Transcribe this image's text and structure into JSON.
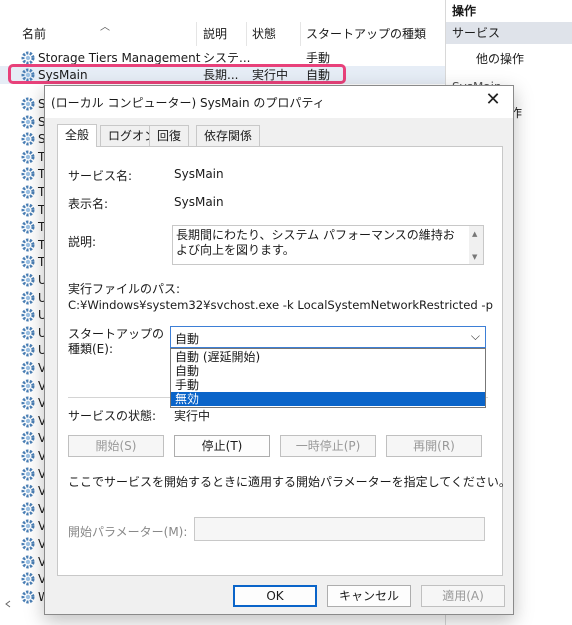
{
  "services_list": {
    "columns": {
      "name": "名前",
      "description": "説明",
      "status": "状態",
      "startup_type": "スタートアップの種類"
    },
    "rows": [
      {
        "name": "Storage Tiers Management",
        "description": "システ...",
        "status": "",
        "startup": "手動"
      },
      {
        "name": "SysMain",
        "description": "長期...",
        "status": "実行中",
        "startup": "自動"
      }
    ],
    "partial_rows": [
      "S",
      "S",
      "S",
      "T",
      "T",
      "T",
      "T",
      "T",
      "T",
      "T",
      "U",
      "U",
      "U",
      "U",
      "U",
      "V",
      "V",
      "V",
      "V",
      "V",
      "V",
      "V",
      "V",
      "V",
      "V",
      "V",
      "V",
      "V",
      "W"
    ]
  },
  "actions_pane": {
    "title": "操作",
    "section": "サービス",
    "item": "他の操作",
    "peek1": "SysMain",
    "peek2": "作"
  },
  "dialog": {
    "title": "(ローカル コンピューター) SysMain のプロパティ",
    "tabs": [
      {
        "label": "全般",
        "active": true
      },
      {
        "label": "ログオン",
        "active": false
      },
      {
        "label": "回復",
        "active": false
      },
      {
        "label": "依存関係",
        "active": false
      }
    ],
    "service_name_label": "サービス名:",
    "service_name": "SysMain",
    "display_name_label": "表示名:",
    "display_name": "SysMain",
    "description_label": "説明:",
    "description": "長期間にわたり、システム パフォーマンスの維持および向上を図ります。",
    "exe_path_label": "実行ファイルのパス:",
    "exe_path": "C:¥Windows¥system32¥svchost.exe -k LocalSystemNetworkRestricted -p",
    "startup_type_label_1": "スタートアップの",
    "startup_type_label_2": "種類(E):",
    "startup_type_value": "自動",
    "startup_options": [
      "自動 (遅延開始)",
      "自動",
      "手動",
      "無効"
    ],
    "startup_highlighted": "無効",
    "service_status_label": "サービスの状態:",
    "service_status": "実行中",
    "buttons": {
      "start": "開始(S)",
      "stop": "停止(T)",
      "pause": "一時停止(P)",
      "resume": "再開(R)"
    },
    "param_hint": "ここでサービスを開始するときに適用する開始パラメーターを指定してください。",
    "param_label": "開始パラメーター(M):",
    "param_value": "",
    "ok": "OK",
    "cancel": "キャンセル",
    "apply": "適用(A)"
  },
  "colors": {
    "highlight_border": "#e8417a",
    "selection": "#0a64c9",
    "focus_border": "#3d7fd6"
  }
}
